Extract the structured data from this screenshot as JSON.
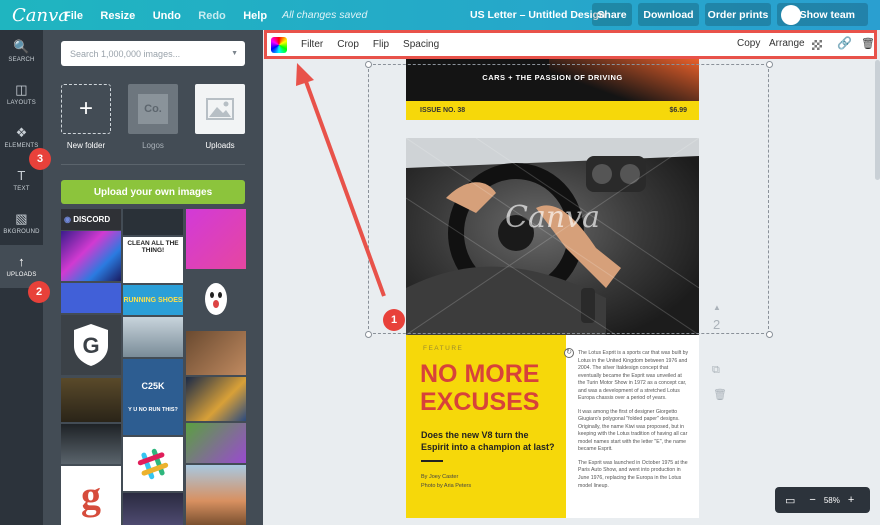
{
  "topbar": {
    "logo": "Canva",
    "menu": [
      "File",
      "Resize",
      "Undo",
      "Redo",
      "Help"
    ],
    "status": "All changes saved",
    "doc_title": "US Letter – Untitled Design",
    "share": "Share",
    "download": "Download",
    "order_prints": "Order prints",
    "show_team": "Show team"
  },
  "rail": [
    {
      "icon": "🔍",
      "label": "SEARCH"
    },
    {
      "icon": "◫",
      "label": "LAYOUTS"
    },
    {
      "icon": "❖",
      "label": "ELEMENTS"
    },
    {
      "icon": "T",
      "label": "TEXT"
    },
    {
      "icon": "▧",
      "label": "BKGROUND"
    },
    {
      "icon": "↑",
      "label": "UPLOADS"
    }
  ],
  "panel": {
    "search_placeholder": "Search 1,000,000 images...",
    "new_folder": "New folder",
    "logos": "Logos",
    "logos_mark": "Co.",
    "uploads": "Uploads",
    "upload_button": "Upload your own images"
  },
  "thumbs": {
    "discord": "DISCORD",
    "clean": "CLEAN ALL THE THING!",
    "running": "RUNNING SHOES",
    "shield": "G",
    "c25k": "C25K",
    "c25k_sub": "Y U NO RUN THIS?",
    "g": "g"
  },
  "toolbar": {
    "filter": "Filter",
    "crop": "Crop",
    "flip": "Flip",
    "spacing": "Spacing",
    "copy": "Copy",
    "arrange": "Arrange"
  },
  "page1": {
    "headline": "CARS + THE PASSION OF DRIVING",
    "issue": "ISSUE NO. 38",
    "price": "$6.99"
  },
  "page2": {
    "watermark": "Canva",
    "feature": "FEATURE",
    "title1": "NO MORE",
    "title2": "EXCUSES",
    "subtitle": "Does the new V8 turn the Espirit into a champion at last?",
    "by1": "By Joey Caster",
    "by2": "Photo by Aria Peters",
    "body1": "The Lotus Esprit is a sports car that was built by Lotus in the United Kingdom between 1976 and 2004. The silver Italdesign concept that eventually became the Esprit was unveiled at the Turin Motor Show in 1972 as a concept car, and was a development of a stretched Lotus Europa chassis over a period of years.",
    "body2": "It was among the first of designer Giorgetto Giugiaro's polygonal \"folded paper\" designs. Originally, the name Kiwi was proposed, but in keeping with the Lotus tradition of having all car model names start with the letter \"E\", the name became Esprit.",
    "body3": "The Esprit was launched in October 1975 at the Paris Auto Show, and went into production in June 1976, replacing the Europa in the Lotus model lineup."
  },
  "page_number": "2",
  "badges": [
    "1",
    "2",
    "3"
  ],
  "zoom": {
    "minus": "−",
    "value": "58%",
    "plus": "+"
  },
  "colors": {
    "accent": "#e8413a",
    "brand_teal": "#1fb5c0",
    "panel": "#434c55",
    "yellow": "#f6d80a",
    "title_red": "#d7423a"
  }
}
